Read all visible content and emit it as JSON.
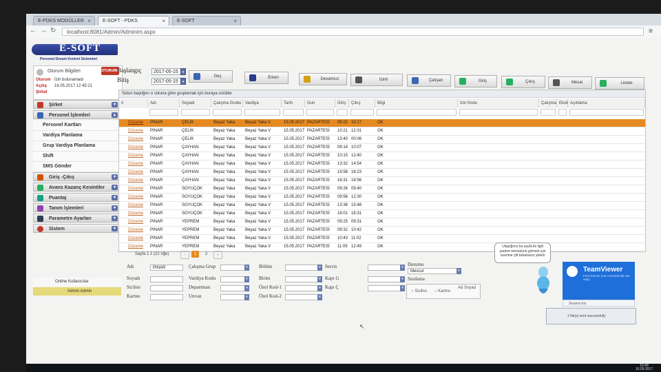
{
  "browser": {
    "tabs": [
      "E-PDKS MODÜLLER",
      "E-SOFT - PDKS",
      "E-SOFT"
    ],
    "url": "localhost:8081/Admin/Adminim.aspx"
  },
  "logo": {
    "title": "E-SOFT",
    "subtitle": "Personel Devam Kontrol Sistemleri"
  },
  "user": {
    "title": "Oturum Bilgileri",
    "kapat": "OTURUMU KAPAT",
    "oturum_label": "Oturum",
    "oturum_value": "İzin bulunamadı",
    "acilis_label": "Açılış",
    "acilis_value": "16.05.2017 12:45:21",
    "sirket_label": "Şirket"
  },
  "menu": {
    "sirket": "Şirket",
    "personel": "Personel İşlemleri",
    "sub": [
      "Personel Kartları",
      "Vardiya Planlama",
      "Grup Vardiya Planlama",
      "Shift",
      "SMS Gönder"
    ],
    "others": [
      "Giriş -Çıkış",
      "Avans Kazanç Kesintiler",
      "Puantaj",
      "Tanım İşlemleri",
      "Parametre Ayarları",
      "Sistem"
    ],
    "online": "Online Kullanıcılar",
    "admin": "Admin Admin"
  },
  "dates": {
    "baslangic_label": "Başlangıç",
    "baslangic_value": "2017-05-15",
    "bitis_label": "Bitiş",
    "bitis_value": "2017-05-15"
  },
  "toolbar": [
    "Geç",
    "Erken",
    "Devamsız",
    "İzinli",
    "Çalışan",
    "Giriş",
    "Çıkış",
    "Mesai",
    "Listele"
  ],
  "grid": {
    "group_hint": "Sütun başlığını o sütuna göre gruplamak için buraya sürükle",
    "headers": [
      "#",
      "Adı",
      "Soyadı",
      "Çalışma Grubu",
      "Vardiya",
      "Tarih",
      "Gun",
      "Giriş",
      "Çıkış",
      "Bilgi",
      "İzin Kodu",
      "Çalışma",
      "Eksik",
      "Açıklama"
    ],
    "rows": [
      [
        "Düzenle",
        "PINAR",
        "ÇELİK",
        "Beyaz Yaka",
        "Beyaz Yaka V",
        "15.05.2017",
        "PAZARTESİ",
        "09:22",
        "10:17",
        "OK"
      ],
      [
        "Düzenle",
        "PINAR",
        "ÇELİK",
        "Beyaz Yaka",
        "Beyaz Yaka V",
        "15.05.2017",
        "PAZARTESİ",
        "10:21",
        "12:31",
        "OK"
      ],
      [
        "Düzenle",
        "PINAR",
        "ÇELİK",
        "Beyaz Yaka",
        "Beyaz Yaka V",
        "15.05.2017",
        "PAZARTESİ",
        "13:40",
        "00:06",
        "OK"
      ],
      [
        "Düzenle",
        "PINAR",
        "ÇAYHAN",
        "Beyaz Yaka",
        "Beyaz Yaka V",
        "15.05.2017",
        "PAZARTESİ",
        "09:14",
        "10:07",
        "OK"
      ],
      [
        "Düzenle",
        "PINAR",
        "ÇAYHAN",
        "Beyaz Yaka",
        "Beyaz Yaka V",
        "15.05.2017",
        "PAZARTESİ",
        "10:15",
        "12:40",
        "OK"
      ],
      [
        "Düzenle",
        "PINAR",
        "ÇAYHAN",
        "Beyaz Yaka",
        "Beyaz Yaka V",
        "15.05.2017",
        "PAZARTESİ",
        "13:32",
        "14:54",
        "OK"
      ],
      [
        "Düzenle",
        "PINAR",
        "ÇAYHAN",
        "Beyaz Yaka",
        "Beyaz Yaka V",
        "15.05.2017",
        "PAZARTESİ",
        "15:58",
        "16:23",
        "OK"
      ],
      [
        "Düzenle",
        "PINAR",
        "ÇAYHAN",
        "Beyaz Yaka",
        "Beyaz Yaka V",
        "15.05.2017",
        "PAZARTESİ",
        "16:31",
        "18:56",
        "OK"
      ],
      [
        "Düzenle",
        "PINAR",
        "SOYUÇOK",
        "Beyaz Yaka",
        "Beyaz Yaka V",
        "15.05.2017",
        "PAZARTESİ",
        "09:26",
        "09:40",
        "OK"
      ],
      [
        "Düzenle",
        "PINAR",
        "SOYUÇOK",
        "Beyaz Yaka",
        "Beyaz Yaka V",
        "15.05.2017",
        "PAZARTESİ",
        "09:56",
        "12:30",
        "OK"
      ],
      [
        "Düzenle",
        "PINAR",
        "SOYUÇOK",
        "Beyaz Yaka",
        "Beyaz Yaka V",
        "15.05.2017",
        "PAZARTESİ",
        "13:38",
        "15:48",
        "OK"
      ],
      [
        "Düzenle",
        "PINAR",
        "SOYUÇOK",
        "Beyaz Yaka",
        "Beyaz Yaka V",
        "15.05.2017",
        "PAZARTESİ",
        "16:01",
        "18:31",
        "OK"
      ],
      [
        "Düzenle",
        "PINAR",
        "YEPREM",
        "Beyaz Yaka",
        "Beyaz Yaka V",
        "15.05.2017",
        "PAZARTESİ",
        "09:25",
        "09:31",
        "OK"
      ],
      [
        "Düzenle",
        "PINAR",
        "YEPREM",
        "Beyaz Yaka",
        "Beyaz Yaka V",
        "15.05.2017",
        "PAZARTESİ",
        "09:32",
        "10:42",
        "OK"
      ],
      [
        "Düzenle",
        "PINAR",
        "YEPREM",
        "Beyaz Yaka",
        "Beyaz Yaka V",
        "15.05.2017",
        "PAZARTESİ",
        "10:43",
        "11:02",
        "OK"
      ],
      [
        "Düzenle",
        "PINAR",
        "YEPREM",
        "Beyaz Yaka",
        "Beyaz Yaka V",
        "15.05.2017",
        "PAZARTESİ",
        "11:09",
        "12:49",
        "OK"
      ]
    ]
  },
  "pager": {
    "info": "Sayfa 1 2 (22 öğe)",
    "pages": [
      "1",
      "2"
    ]
  },
  "filters": {
    "adi_label": "Adı",
    "adi_value": "PINAR",
    "soyadi_label": "Soyadı",
    "sicilno_label": "Sicilno",
    "kartno_label": "Kartno",
    "calisma_grup_label": "Çalışma Grup",
    "vardiya_kodu_label": "Vardiya Kodu",
    "departman_label": "Departman",
    "unvan_label": "Unvan",
    "bolum_label": "Bölüm",
    "birim_label": "Birim",
    "ozel_kod1_label": "Özel Kod-1",
    "ozel_kod2_label": "Özel Kod-2",
    "servis_label": "Servis",
    "kapi_g_label": "Kapı G",
    "kapi_c_label": "Kapı Ç",
    "durumu_label": "Durumu",
    "durumu_value": "Mevcut",
    "siralama_label": "Sıralama",
    "radio_sicilno": "Sicilno",
    "radio_kartno": "Kartno",
    "radio_adsoyad": "Ad Soyad"
  },
  "tooltip": "Ulaşılğınız bu sayfa ile ilgili yardım menüsünü görmek için üzerime çift tıklamanız yeterli",
  "teamviewer": {
    "name": "TeamViewer",
    "small": "Free license (non-commercial use only)",
    "sessions": "Session list"
  },
  "notif": "1 file(s) sent successfully",
  "taskbar": {
    "time": "15:49",
    "date": "16.05.2017"
  },
  "colors": {
    "accent_orange": "#e58a22",
    "brand_blue": "#2a3a8c"
  }
}
